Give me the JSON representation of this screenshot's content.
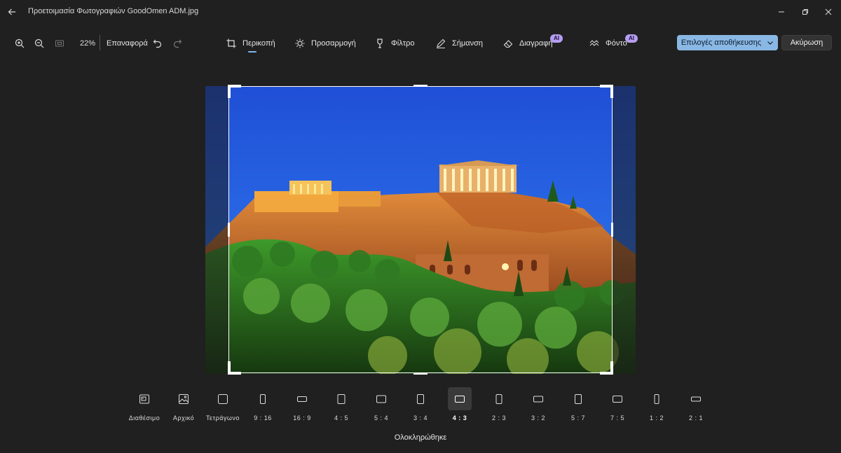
{
  "window": {
    "title": "Προετοιμασία Φωτογραφιών GoodOmen ADM.jpg"
  },
  "toolbar": {
    "zoom_percent": "22%",
    "reset_label": "Επαναφορά",
    "tabs": [
      {
        "label": "Περικοπή",
        "icon": "crop-icon",
        "active": true
      },
      {
        "label": "Προσαρμογή",
        "icon": "brightness-icon"
      },
      {
        "label": "Φίλτρο",
        "icon": "filter-icon"
      },
      {
        "label": "Σήμανση",
        "icon": "pen-icon"
      },
      {
        "label": "Διαγραφή",
        "icon": "eraser-icon",
        "badge": "AI"
      },
      {
        "label": "Φόντο",
        "icon": "background-icon",
        "badge": "AI"
      }
    ],
    "save_label": "Επιλογές αποθήκευσης",
    "cancel_label": "Ακύρωση"
  },
  "aspect_ratios": [
    {
      "label": "Διαθέσιμο"
    },
    {
      "label": "Αρχικό"
    },
    {
      "label": "Τετράγωνο"
    },
    {
      "label": "9 : 16"
    },
    {
      "label": "16 : 9"
    },
    {
      "label": "4 : 5"
    },
    {
      "label": "5 : 4"
    },
    {
      "label": "3 : 4"
    },
    {
      "label": "4 : 3",
      "selected": true
    },
    {
      "label": "2 : 3"
    },
    {
      "label": "3 : 2"
    },
    {
      "label": "5 : 7"
    },
    {
      "label": "7 : 5"
    },
    {
      "label": "1 : 2"
    },
    {
      "label": "2 : 1"
    }
  ],
  "done_label": "Ολοκληρώθηκε",
  "colors": {
    "accent": "#8ab8e4",
    "ai_badge": "#b59ef0",
    "background": "#202020"
  }
}
